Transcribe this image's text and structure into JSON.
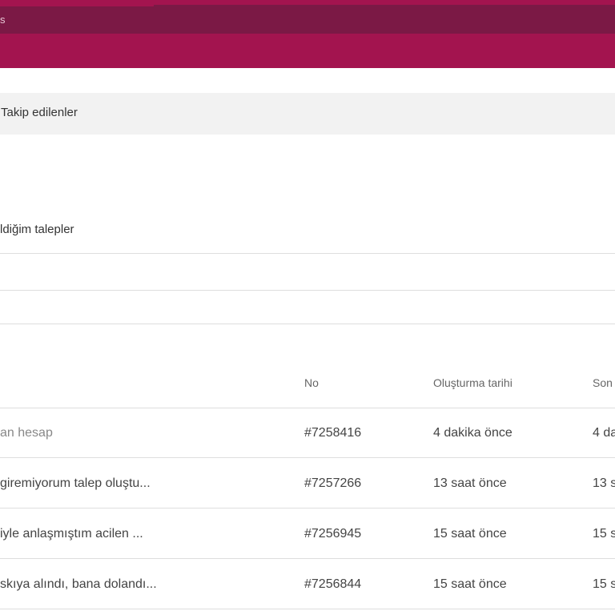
{
  "header": {
    "nav_text": "s"
  },
  "followed": {
    "label": "Takip edilenler"
  },
  "section": {
    "title": "ldiğim talepler"
  },
  "table": {
    "columns": [
      "No",
      "Oluşturma tarihi",
      "Son"
    ],
    "rows": [
      {
        "subject": "an hesap",
        "no": "#7258416",
        "created": "4 dakika önce",
        "updated": "4 da"
      },
      {
        "subject": "giremiyorum talep oluştu...",
        "no": "#7257266",
        "created": "13 saat önce",
        "updated": "13 s"
      },
      {
        "subject": "iyle anlaşmıştım acilen ...",
        "no": "#7256945",
        "created": "15 saat önce",
        "updated": "15 s"
      },
      {
        "subject": "skıya alındı, bana dolandı...",
        "no": "#7256844",
        "created": "15 saat önce",
        "updated": "15 s"
      }
    ]
  },
  "colors": {
    "brand": "#a3144f",
    "brand_dark": "#7b1945",
    "panel": "#f2f2f2"
  }
}
